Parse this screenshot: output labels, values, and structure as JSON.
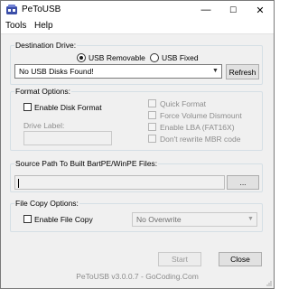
{
  "window": {
    "title": "PeToUSB",
    "controls": {
      "minimize": "—",
      "maximize": "☐",
      "close": "✕"
    }
  },
  "menu": {
    "items": [
      "Tools",
      "Help"
    ]
  },
  "destination": {
    "group_label": "Destination Drive:",
    "usb_removable": "USB Removable",
    "usb_fixed": "USB Fixed",
    "selected_type": "USB Removable",
    "drive_select_value": "No USB Disks Found!",
    "refresh_label": "Refresh"
  },
  "format": {
    "group_label": "Format Options:",
    "enable_disk_format": "Enable Disk Format",
    "drive_label_caption": "Drive Label:",
    "drive_label_value": "",
    "quick_format": "Quick Format",
    "force_volume_dismount": "Force Volume Dismount",
    "enable_lba": "Enable LBA (FAT16X)",
    "dont_rewrite_mbr": "Don't rewrite MBR code"
  },
  "source": {
    "group_label": "Source Path To Built BartPE/WinPE Files:",
    "path_value": "",
    "browse_label": "..."
  },
  "file_copy": {
    "group_label": "File Copy Options:",
    "enable_file_copy": "Enable File Copy",
    "overwrite_select_value": "No Overwrite"
  },
  "actions": {
    "start_label": "Start",
    "close_label": "Close"
  },
  "footer": {
    "version_text": "PeToUSB v3.0.0.7 - GoCoding.Com"
  },
  "colors": {
    "window_bg": "#f0f0f0",
    "titlebar_bg": "#ffffff",
    "group_border": "#d5dfe5"
  }
}
